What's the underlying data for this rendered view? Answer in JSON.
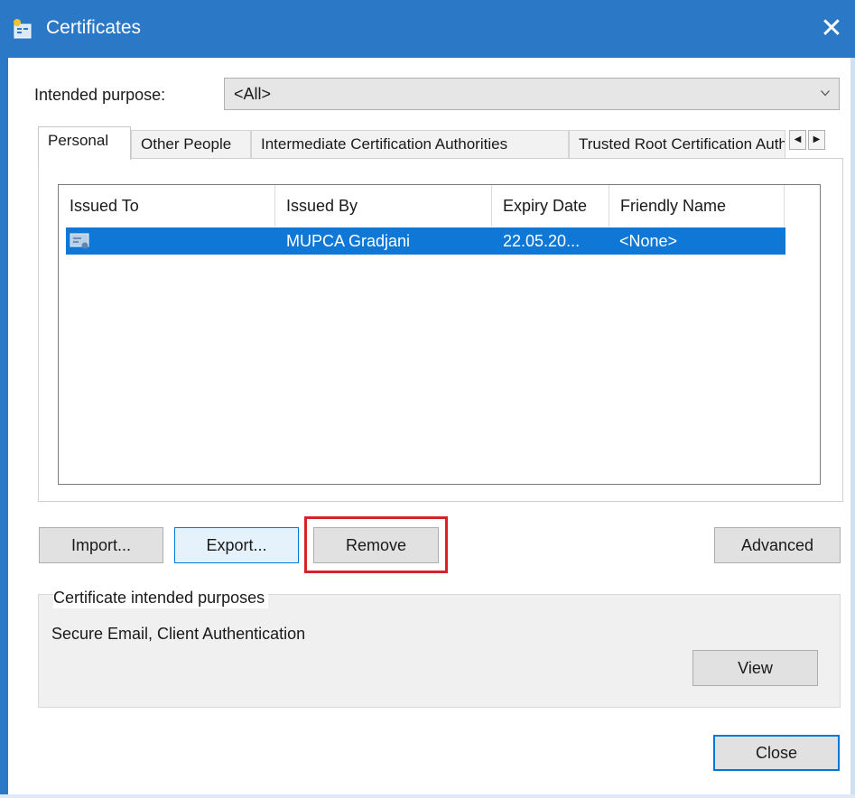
{
  "window": {
    "title": "Certificates",
    "close_glyph": "✕",
    "icon": "certificates-icon"
  },
  "purpose": {
    "label": "Intended purpose:",
    "value": "<All>",
    "icon": "chevron-down-icon"
  },
  "tabs": [
    {
      "label": "Personal",
      "active": true
    },
    {
      "label": "Other People",
      "active": false
    },
    {
      "label": "Intermediate Certification Authorities",
      "active": false
    },
    {
      "label": "Trusted Root Certification Authorities",
      "active": false
    }
  ],
  "tab_scroll": {
    "left_glyph": "◀",
    "right_glyph": "▶"
  },
  "list": {
    "columns": [
      "Issued To",
      "Issued By",
      "Expiry Date",
      "Friendly Name"
    ],
    "rows": [
      {
        "issued_to": "",
        "issued_by": "MUPCA Gradjani",
        "expiry": "22.05.20...",
        "friendly": "<None>",
        "selected": true,
        "icon": "certificate-icon"
      }
    ]
  },
  "buttons": {
    "import": "Import...",
    "export": "Export...",
    "remove": "Remove",
    "advanced": "Advanced",
    "view": "View",
    "close": "Close"
  },
  "purposes_group": {
    "title": "Certificate intended purposes",
    "text": "Secure Email, Client Authentication"
  },
  "colors": {
    "titlebar": "#2b78c7",
    "selection": "#0f78d7",
    "highlight": "#d8222a"
  }
}
